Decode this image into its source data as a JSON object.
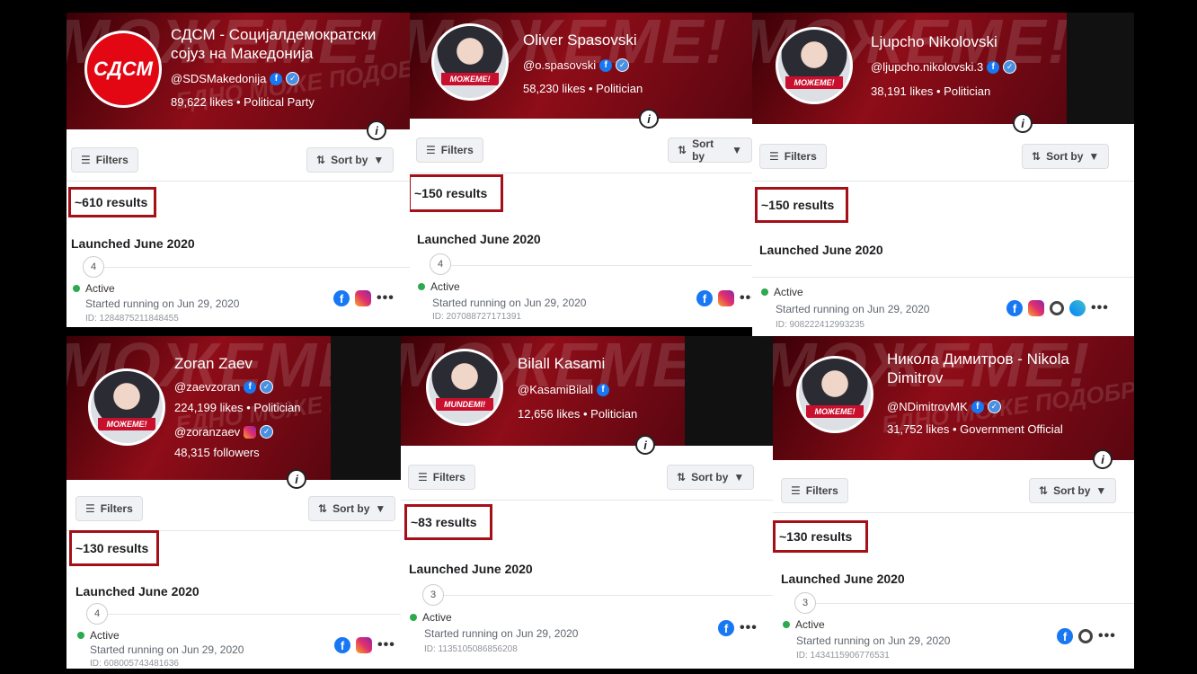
{
  "common": {
    "filters": "Filters",
    "sort": "Sort by",
    "launched": "Launched June 2020",
    "active": "Active",
    "started": "Started running on Jun 29, 2020",
    "info": "i",
    "more": "•••",
    "fb": "f",
    "ver": "✓"
  },
  "panels": [
    {
      "name": "СДСМ - Социјалдемократски",
      "name2": "сојуз на Македонија",
      "handle": "@SDSMakedonija",
      "likes": "89,622 likes",
      "category": "Political Party",
      "logo": "СДСМ",
      "results": "~610 results",
      "count": "4",
      "id": "ID: 1284875211848455"
    },
    {
      "name": "Oliver Spasovski",
      "handle": "@o.spasovski",
      "likes": "58,230 likes",
      "category": "Politician",
      "tag": "МОЖЕМЕ!",
      "results": "~150 results",
      "count": "4",
      "id": "ID: 207088727171391"
    },
    {
      "name": "Ljupcho Nikolovski",
      "handle": "@ljupcho.nikolovski.3",
      "likes": "38,191 likes",
      "category": "Politician",
      "tag": "МОЖЕМЕ!",
      "results": "~150 results",
      "id": "ID: 908222412993235"
    },
    {
      "name": "Zoran Zaev",
      "handle": "@zaevzoran",
      "likes": "224,199 likes",
      "category": "Politician",
      "handle2": "@zoranzaev",
      "followers": "48,315 followers",
      "tag": "МОЖЕМЕ!",
      "results": "~130 results",
      "count": "4",
      "id": "ID: 608005743481636"
    },
    {
      "name": "Bilall Kasami",
      "handle": "@KasamiBilall",
      "likes": "12,656 likes",
      "category": "Politician",
      "tag": "MUNDEMI!",
      "results": "~83 results",
      "count": "3",
      "id": "ID: 1135105086856208"
    },
    {
      "name": "Никола Димитров - Nikola",
      "name2": "Dimitrov",
      "handle": "@NDimitrovMK",
      "likes": "31,752 likes",
      "category": "Government Official",
      "tag": "МОЖЕМЕ!",
      "results": "~130 results",
      "count": "3",
      "id": "ID: 1434115906776531"
    }
  ],
  "banner": {
    "slogan": "МОЖЕМЕ!",
    "slogan2": "ЕДНО МОЖЕ ПОДОБРО."
  }
}
